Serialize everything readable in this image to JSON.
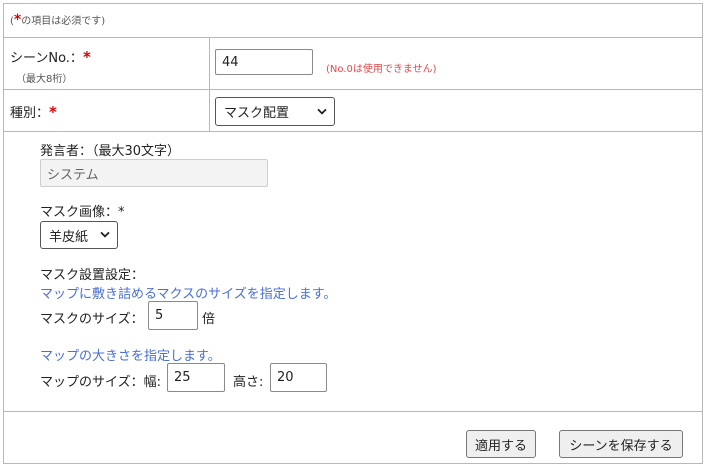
{
  "form": {
    "required_note_star": "*",
    "required_note": "の項目は必須です)",
    "required_note_open": "(",
    "scene_no": {
      "label": "シーンNo.：",
      "star": "*",
      "sublabel": "（最大8桁）",
      "value": "44",
      "warning": "(No.0は使用できません)"
    },
    "type": {
      "label": "種別：",
      "star": "*",
      "selected": "マスク配置"
    },
    "speaker": {
      "label": "発言者：（最大30文字）",
      "value": "システム"
    },
    "mask_image": {
      "label": "マスク画像：*",
      "selected": "羊皮紙"
    },
    "mask_settings": {
      "label": "マスク設置設定：",
      "hint": "マップに敷き詰めるマクスのサイズを指定します。",
      "size_label": "マスクのサイズ：",
      "size_value": "5",
      "size_unit": "倍"
    },
    "map_size": {
      "hint": "マップの大きさを指定します。",
      "label": "マップのサイズ：幅:",
      "width_value": "25",
      "height_label": "高さ:",
      "height_value": "20"
    }
  },
  "buttons": {
    "apply": "適用する",
    "save_scene": "シーンを保存する"
  },
  "icons": {
    "select_arrow": "chevron-down-icon"
  }
}
